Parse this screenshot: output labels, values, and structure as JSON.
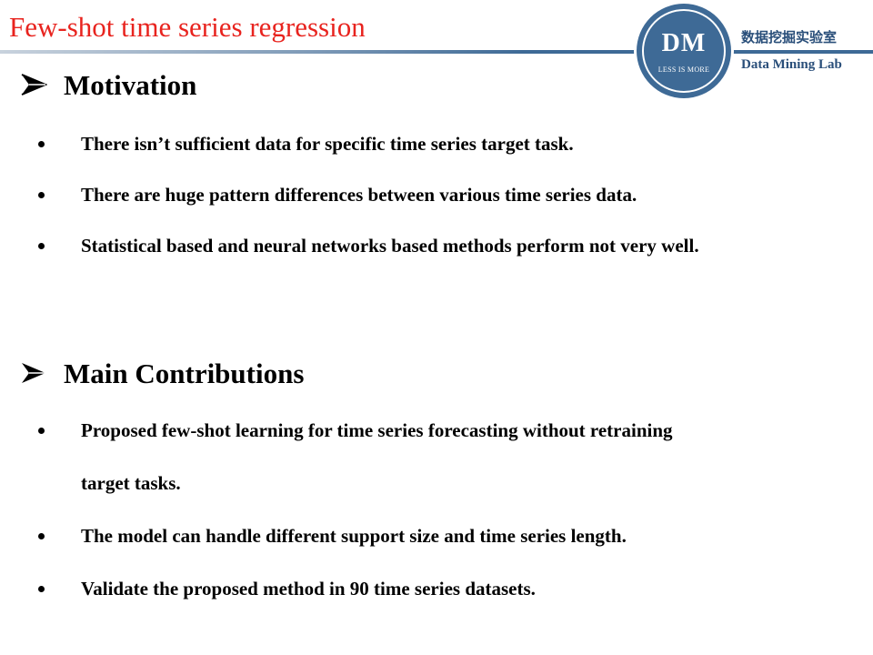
{
  "header": {
    "title": "Few-shot time series regression",
    "logo": {
      "initials": "DM",
      "motto": "LESS IS MORE"
    },
    "lab_name_cn": "数据挖掘实验室",
    "lab_name_en": "Data Mining Lab"
  },
  "colors": {
    "title_red": "#e8231e",
    "brand_blue": "#3e6a96",
    "lab_text": "#2a4f7a"
  },
  "sections": [
    {
      "title": "Motivation",
      "bullets": [
        "There isn’t sufficient data for specific time series target task.",
        "There are huge pattern differences between various time series data.",
        "Statistical based and neural networks based methods perform not very well."
      ]
    },
    {
      "title": "Main Contributions",
      "bullets": [
        "Proposed few-shot learning for time series forecasting without retraining target tasks.",
        "The model can handle different support size and time series length.",
        "Validate the proposed method in 90 time series datasets."
      ]
    }
  ],
  "icons": {
    "section_marker": "arrow-bullet-icon",
    "list_marker": "dot-bullet-icon"
  }
}
